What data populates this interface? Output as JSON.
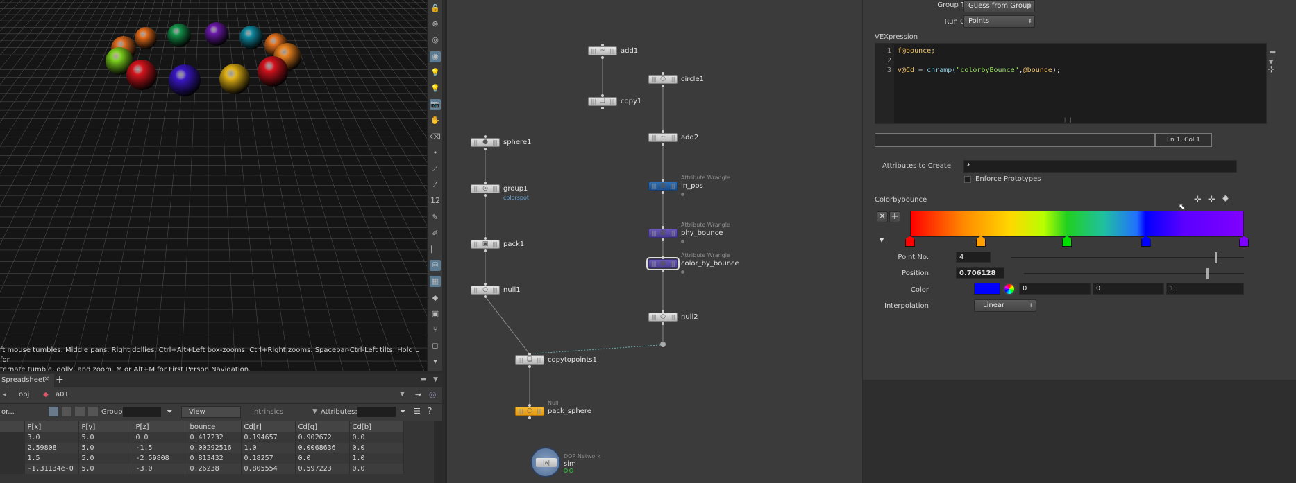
{
  "viewport": {
    "hint_line1": "ft mouse tumbles. Middle pans. Right dollies. Ctrl+Alt+Left box-zooms. Ctrl+Right zooms. Spacebar-Ctrl-Left tilts. Hold L for",
    "hint_line2": "ternate tumble, dolly, and zoom.     M or Alt+M for First Person Navigation.",
    "spheres": [
      {
        "color": "#dd6a1f"
      },
      {
        "color": "#e26a1a"
      },
      {
        "color": "#14934a"
      },
      {
        "color": "#6b19ab"
      },
      {
        "color": "#0f8aa0"
      },
      {
        "color": "#e2701c"
      },
      {
        "color": "#e5801e"
      },
      {
        "color": "#7cd11d"
      },
      {
        "color": "#d4141c"
      },
      {
        "color": "#3a17c4"
      },
      {
        "color": "#e0b014"
      },
      {
        "color": "#d3121d"
      }
    ]
  },
  "vtools": [
    "lock-icon",
    "close-circle-icon",
    "target-icon",
    "pin-icon",
    "bulb-icon",
    "bulb-alt-icon",
    "camera-icon",
    "hand-icon",
    "trash-icon",
    "dot-icon",
    "line-icon",
    "picker-icon",
    "number-icon",
    "brush-icon",
    "brush-alt-icon",
    "ruler-icon",
    "bird-icon",
    "checker-icon",
    "diamond-icon",
    "box-icon",
    "branch-icon",
    "square-icon",
    "arrow-down-icon"
  ],
  "spreadsheet": {
    "tab_label": "Spreadsheet",
    "path_obj": "obj",
    "path_node": "a01",
    "group_label": "Group:",
    "view_label": "View",
    "intrinsics_label": "Intrinsics",
    "attributes_label": "Attributes:",
    "left_label": "or...",
    "columns": [
      "P[x]",
      "P[y]",
      "P[z]",
      "bounce",
      "Cd[r]",
      "Cd[g]",
      "Cd[b]"
    ],
    "rows": [
      [
        "3.0",
        "5.0",
        "0.0",
        "0.417232",
        "0.194657",
        "0.902672",
        "0.0"
      ],
      [
        "2.59808",
        "5.0",
        "-1.5",
        "0.00292516",
        "1.0",
        "0.0068636",
        "0.0"
      ],
      [
        "1.5",
        "5.0",
        "-2.59808",
        "0.813432",
        "0.18257",
        "0.0",
        "1.0"
      ],
      [
        "-1.31134e-0",
        "5.0",
        "-3.0",
        "0.26238",
        "0.805554",
        "0.597223",
        "0.0"
      ]
    ]
  },
  "network": {
    "nodes": {
      "add1": {
        "label": "add1"
      },
      "copy1": {
        "label": "copy1"
      },
      "circle1": {
        "label": "circle1"
      },
      "add2": {
        "label": "add2"
      },
      "sphere1": {
        "label": "sphere1"
      },
      "group1": {
        "label": "group1",
        "comment": "colorspot"
      },
      "in_pos": {
        "label": "in_pos",
        "sub": "Attribute Wrangle"
      },
      "phy_bounce": {
        "label": "phy_bounce",
        "sub": "Attribute Wrangle"
      },
      "color_by_bounce": {
        "label": "color_by_bounce",
        "sub": "Attribute Wrangle"
      },
      "pack1": {
        "label": "pack1"
      },
      "null1": {
        "label": "null1"
      },
      "null2": {
        "label": "null2"
      },
      "copytopoints1": {
        "label": "copytopoints1"
      },
      "pack_sphere": {
        "label": "pack_sphere",
        "sub": "Null"
      },
      "sim": {
        "label": "sim",
        "sub": "DOP Network"
      }
    }
  },
  "params": {
    "group_type_label": "Group Type",
    "group_type_value": "Guess from Group",
    "run_over_label": "Run Over",
    "run_over_value": "Points",
    "vexpression_label": "VEXpression",
    "code_line_numbers": [
      "1",
      "2",
      "3"
    ],
    "code_line1": "f@bounce;",
    "code_line3_a": "v@Cd",
    "code_line3_b": " = ",
    "code_line3_c": "chramp(",
    "code_line3_d": "\"colorbyBounce\"",
    "code_line3_e": ",",
    "code_line3_f": "@bounce",
    "code_line3_g": ");",
    "cursor_pos": "Ln 1, Col 1",
    "attrs_create_label": "Attributes to Create",
    "attrs_create_value": "*",
    "enforce_label": "Enforce Prototypes",
    "ramp_title": "Colorbybounce",
    "point_no_label": "Point No.",
    "point_no_value": "4",
    "position_label": "Position",
    "position_value": "0.706128",
    "color_label": "Color",
    "color_r": "0",
    "color_g": "0",
    "color_b": "1",
    "interp_label": "Interpolation",
    "interp_value": "Linear",
    "ramp_keys": [
      {
        "pos": 0.0,
        "color": "#ff0000"
      },
      {
        "pos": 0.212,
        "color": "#ffa000"
      },
      {
        "pos": 0.47,
        "color": "#00e000"
      },
      {
        "pos": 0.706128,
        "color": "#0000ff"
      },
      {
        "pos": 1.0,
        "color": "#8000ff"
      }
    ],
    "accent_color": "#0000ff"
  }
}
